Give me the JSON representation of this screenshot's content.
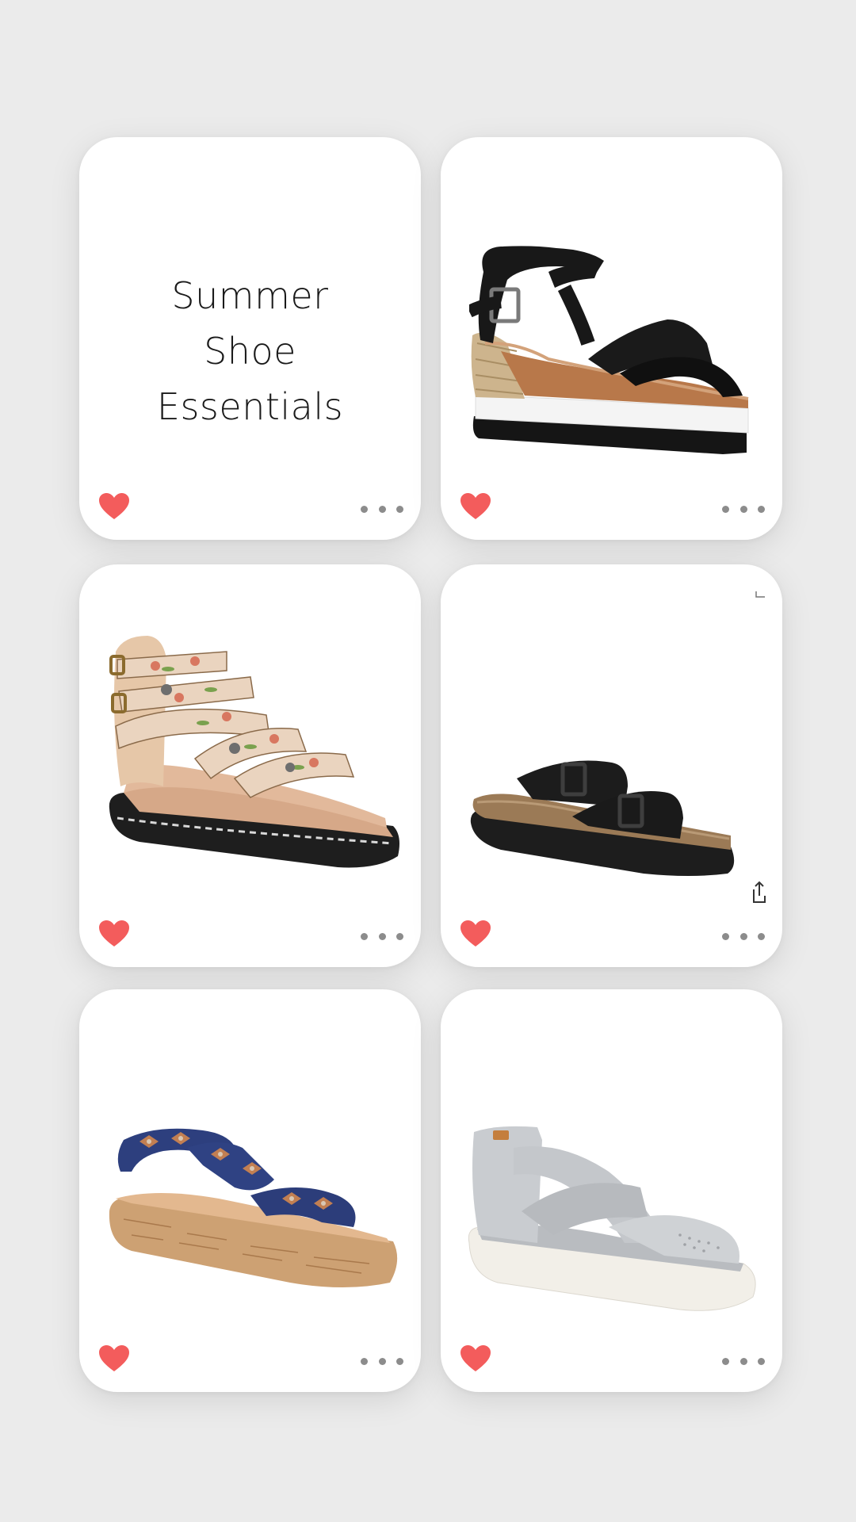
{
  "board": {
    "title_lines": [
      "Summer",
      "Shoe",
      "Essentials"
    ]
  },
  "cards": [
    {
      "kind": "title",
      "liked": true
    },
    {
      "kind": "product",
      "icon": "black-wedge-sandal-image",
      "liked": true
    },
    {
      "kind": "product",
      "icon": "floral-gladiator-sandal-image",
      "liked": true
    },
    {
      "kind": "product",
      "icon": "black-two-strap-slide-image",
      "liked": true
    },
    {
      "kind": "product",
      "icon": "tribal-cork-platform-sandal-image",
      "liked": true
    },
    {
      "kind": "product",
      "icon": "grey-cross-strap-sandal-image",
      "liked": true
    }
  ],
  "colors": {
    "background": "#ebebeb",
    "card": "#ffffff",
    "heart": "#f35c5c",
    "dots": "#8c8c8c"
  }
}
